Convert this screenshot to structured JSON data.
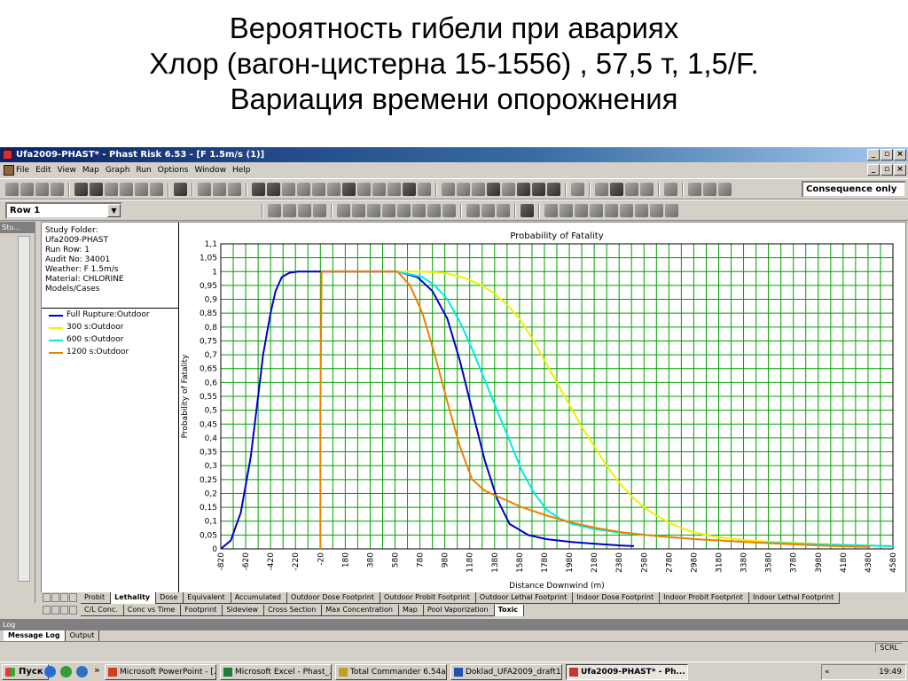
{
  "slide": {
    "title_lines": [
      "Вероятность гибели при авариях",
      "Хлор (вагон-цистерна 15-1556) , 57,5 т, 1,5/F.",
      "Вариация времени опорожнения"
    ]
  },
  "app": {
    "window_title": "Ufa2009-PHAST* - Phast Risk 6.53 - [F 1.5m/s (1)]",
    "menu": [
      "File",
      "Edit",
      "View",
      "Map",
      "Graph",
      "Run",
      "Options",
      "Window",
      "Help"
    ],
    "row_combo": "Row 1",
    "consequence_combo": "Consequence only",
    "side_panel_title": "Stu..."
  },
  "info_panel": {
    "lines": [
      "Study Folder:",
      "Ufa2009-PHAST",
      "Run Row: 1",
      "Audit No: 34001",
      "Weather: F 1.5m/s",
      "Material: CHLORINE",
      "Models/Cases"
    ]
  },
  "tabs_row1": [
    "Probit",
    "Lethality",
    "Dose",
    "Equivalent",
    "Accumulated",
    "Outdoor Dose Footprint",
    "Outdoor Probit Footprint",
    "Outdoor Lethal Footprint",
    "Indoor Dose Footprint",
    "Indoor Probit Footprint",
    "Indoor Lethal Footprint"
  ],
  "tabs_row1_active": "Lethality",
  "tabs_row2": [
    "C/L Conc.",
    "Conc vs Time",
    "Footprint",
    "Sideview",
    "Cross Section",
    "Max Concentration",
    "Map",
    "Pool Vaporization",
    "Toxic"
  ],
  "tabs_row2_active": "Toxic",
  "log": {
    "title": "Log",
    "tabs": [
      "Message Log",
      "Output"
    ],
    "status": "SCRL"
  },
  "taskbar": {
    "start": "Пуск",
    "chevron": "»",
    "buttons": [
      "Microsoft PowerPoint - [...",
      "Microsoft Excel - Phast_...",
      "Total Commander 6.54a ...",
      "Doklad_UFA2009_draft1...",
      "Ufa2009-PHAST* - Ph..."
    ],
    "active_button": "Ufa2009-PHAST* - Ph...",
    "tray_prefix": "«",
    "clock": "19:49"
  },
  "colors": {
    "grid": "#00a000",
    "full_rupture": "#0000c8",
    "s300": "#f0f000",
    "s600": "#00e8e8",
    "s1200": "#f08000"
  },
  "chart_data": {
    "type": "line",
    "title": "Probability of Fatality",
    "xlabel": "Distance Downwind (m)",
    "ylabel": "Probability of Fatality",
    "xlim": [
      -820,
      4580
    ],
    "ylim": [
      0,
      1.1
    ],
    "x_ticks": [
      "-820",
      "-620",
      "-420",
      "-220",
      "-20",
      "180",
      "380",
      "580",
      "780",
      "980",
      "1180",
      "1380",
      "1580",
      "1780",
      "1980",
      "2180",
      "2380",
      "2580",
      "2780",
      "2980",
      "3180",
      "3380",
      "3580",
      "3780",
      "3980",
      "4180",
      "4380",
      "4580"
    ],
    "y_ticks": [
      "0",
      "0,05",
      "0,1",
      "0,15",
      "0,2",
      "0,25",
      "0,3",
      "0,35",
      "0,4",
      "0,45",
      "0,5",
      "0,55",
      "0,6",
      "0,65",
      "0,7",
      "0,75",
      "0,8",
      "0,85",
      "0,9",
      "0,95",
      "1",
      "1,05",
      "1,1"
    ],
    "grid": true,
    "legend_position": "left panel",
    "series": [
      {
        "name": "Full Rupture:Outdoor",
        "color": "#0000c8",
        "x": [
          -820,
          -740,
          -660,
          -580,
          -520,
          -480,
          -420,
          -380,
          -330,
          -270,
          -200,
          -120,
          -20,
          100,
          300,
          500,
          600,
          760,
          880,
          1000,
          1100,
          1200,
          1300,
          1400,
          1500,
          1650,
          1800,
          2000,
          2200,
          2400,
          2500
        ],
        "y": [
          0,
          0.03,
          0.13,
          0.33,
          0.55,
          0.7,
          0.85,
          0.93,
          0.98,
          0.995,
          1,
          1,
          1,
          1,
          1,
          1,
          1,
          0.98,
          0.93,
          0.83,
          0.68,
          0.5,
          0.32,
          0.18,
          0.09,
          0.05,
          0.035,
          0.025,
          0.018,
          0.012,
          0.01
        ]
      },
      {
        "name": "300 s:Outdoor",
        "color": "#f0f000",
        "x": [
          580,
          780,
          980,
          1080,
          1180,
          1280,
          1380,
          1480,
          1580,
          1680,
          1780,
          1880,
          1980,
          2080,
          2180,
          2280,
          2380,
          2480,
          2580,
          2680,
          2780,
          2880,
          2980,
          3080,
          3180,
          3380,
          3580,
          3780,
          3980,
          4180,
          4380,
          4580
        ],
        "y": [
          1,
          1,
          0.995,
          0.985,
          0.97,
          0.95,
          0.92,
          0.88,
          0.83,
          0.76,
          0.68,
          0.6,
          0.52,
          0.44,
          0.37,
          0.3,
          0.24,
          0.19,
          0.15,
          0.12,
          0.095,
          0.075,
          0.06,
          0.05,
          0.042,
          0.032,
          0.026,
          0.022,
          0.018,
          0.015,
          0.012,
          0.01
        ]
      },
      {
        "name": "600 s:Outdoor",
        "color": "#00e8e8",
        "x": [
          580,
          700,
          800,
          900,
          1000,
          1100,
          1200,
          1300,
          1400,
          1500,
          1600,
          1700,
          1800,
          1900,
          2000,
          2100,
          2200,
          2400,
          2600,
          2800,
          3000,
          3200,
          3400,
          3600,
          3800,
          4000,
          4200,
          4400,
          4580
        ],
        "y": [
          1,
          0.99,
          0.98,
          0.95,
          0.9,
          0.82,
          0.72,
          0.61,
          0.5,
          0.39,
          0.28,
          0.2,
          0.14,
          0.11,
          0.09,
          0.08,
          0.07,
          0.058,
          0.05,
          0.042,
          0.035,
          0.03,
          0.025,
          0.022,
          0.019,
          0.016,
          0.014,
          0.012,
          0.01
        ]
      },
      {
        "name": "1200 s:Outdoor",
        "color": "#f08000",
        "x": [
          -20,
          -20,
          -10,
          0,
          100,
          300,
          500,
          600,
          700,
          800,
          900,
          1000,
          1100,
          1200,
          1300,
          1400,
          1500,
          1600,
          1800,
          2000,
          2200,
          2400,
          2600,
          2800,
          3000,
          3200,
          3400,
          3600,
          3800,
          4000,
          4200,
          4400
        ],
        "y": [
          0,
          0.5,
          1,
          1,
          1,
          1,
          1,
          1,
          0.95,
          0.85,
          0.7,
          0.53,
          0.37,
          0.25,
          0.21,
          0.19,
          0.17,
          0.15,
          0.12,
          0.095,
          0.075,
          0.06,
          0.05,
          0.042,
          0.035,
          0.03,
          0.025,
          0.02,
          0.016,
          0.012,
          0.009,
          0.007
        ]
      }
    ]
  }
}
